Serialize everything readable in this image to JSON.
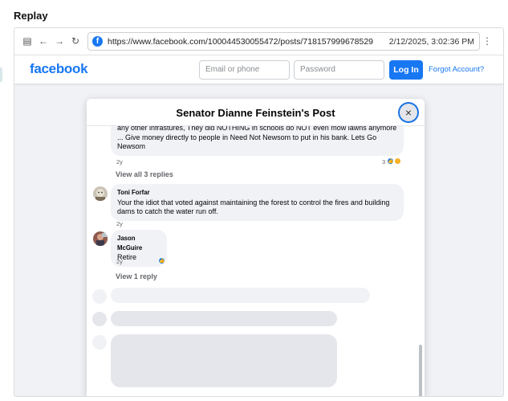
{
  "app": {
    "title": "Replay"
  },
  "browser": {
    "url": "https://www.facebook.com/100044530055472/posts/718157999678529",
    "timestamp": "2/12/2025, 3:02:36 PM",
    "favicon": "f"
  },
  "fb_header": {
    "logo": "facebook",
    "email_placeholder": "Email or phone",
    "password_placeholder": "Password",
    "login_label": "Log In",
    "forgot_label": "Forgot Account?"
  },
  "modal": {
    "title": "Senator Dianne Feinstein's Post",
    "close_glyph": "×"
  },
  "comments": [
    {
      "text": "any other infrastures, They did NOTHING in schools do NOT even mow lawns anymore ... Give money directly to people in Need Not Newsom to put in his bank. Lets Go Newsom",
      "age": "2y",
      "reaction_count": "3"
    },
    {
      "author": "Toni Forfar",
      "text": "Your the idiot that voted against maintaining the forest to control the fires and building dams to catch the water run off.",
      "age": "2y"
    },
    {
      "author": "Jason McGuire",
      "text": "Retire",
      "age": "2y"
    }
  ],
  "links": {
    "view_all_replies": "View all 3 replies",
    "view_one_reply": "View 1 reply"
  },
  "colors": {
    "brand": "#1877f2",
    "bubble": "#f0f2f5",
    "muted_text": "#65676b"
  }
}
